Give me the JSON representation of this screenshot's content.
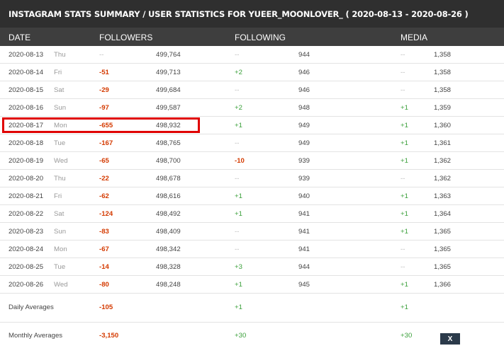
{
  "header": {
    "title": "INSTAGRAM STATS SUMMARY / USER STATISTICS FOR YUEER_MOONLOVER_ ( 2020-08-13 - 2020-08-26 )"
  },
  "columns": {
    "date": "DATE",
    "followers": "FOLLOWERS",
    "following": "FOLLOWING",
    "media": "MEDIA"
  },
  "rows": [
    {
      "date": "2020-08-13",
      "day": "Thu",
      "fd": "--",
      "fv": "499,764",
      "gd": "--",
      "gv": "944",
      "md": "--",
      "mv": "1,358"
    },
    {
      "date": "2020-08-14",
      "day": "Fri",
      "fd": "-51",
      "fv": "499,713",
      "gd": "+2",
      "gv": "946",
      "md": "--",
      "mv": "1,358"
    },
    {
      "date": "2020-08-15",
      "day": "Sat",
      "fd": "-29",
      "fv": "499,684",
      "gd": "--",
      "gv": "946",
      "md": "--",
      "mv": "1,358"
    },
    {
      "date": "2020-08-16",
      "day": "Sun",
      "fd": "-97",
      "fv": "499,587",
      "gd": "+2",
      "gv": "948",
      "md": "+1",
      "mv": "1,359"
    },
    {
      "date": "2020-08-17",
      "day": "Mon",
      "fd": "-655",
      "fv": "498,932",
      "gd": "+1",
      "gv": "949",
      "md": "+1",
      "mv": "1,360"
    },
    {
      "date": "2020-08-18",
      "day": "Tue",
      "fd": "-167",
      "fv": "498,765",
      "gd": "--",
      "gv": "949",
      "md": "+1",
      "mv": "1,361"
    },
    {
      "date": "2020-08-19",
      "day": "Wed",
      "fd": "-65",
      "fv": "498,700",
      "gd": "-10",
      "gv": "939",
      "md": "+1",
      "mv": "1,362"
    },
    {
      "date": "2020-08-20",
      "day": "Thu",
      "fd": "-22",
      "fv": "498,678",
      "gd": "--",
      "gv": "939",
      "md": "--",
      "mv": "1,362"
    },
    {
      "date": "2020-08-21",
      "day": "Fri",
      "fd": "-62",
      "fv": "498,616",
      "gd": "+1",
      "gv": "940",
      "md": "+1",
      "mv": "1,363"
    },
    {
      "date": "2020-08-22",
      "day": "Sat",
      "fd": "-124",
      "fv": "498,492",
      "gd": "+1",
      "gv": "941",
      "md": "+1",
      "mv": "1,364"
    },
    {
      "date": "2020-08-23",
      "day": "Sun",
      "fd": "-83",
      "fv": "498,409",
      "gd": "--",
      "gv": "941",
      "md": "+1",
      "mv": "1,365"
    },
    {
      "date": "2020-08-24",
      "day": "Mon",
      "fd": "-67",
      "fv": "498,342",
      "gd": "--",
      "gv": "941",
      "md": "--",
      "mv": "1,365"
    },
    {
      "date": "2020-08-25",
      "day": "Tue",
      "fd": "-14",
      "fv": "498,328",
      "gd": "+3",
      "gv": "944",
      "md": "--",
      "mv": "1,365"
    },
    {
      "date": "2020-08-26",
      "day": "Wed",
      "fd": "-80",
      "fv": "498,248",
      "gd": "+1",
      "gv": "945",
      "md": "+1",
      "mv": "1,366"
    }
  ],
  "averages": {
    "daily": {
      "label": "Daily Averages",
      "followers": "-105",
      "following": "+1",
      "media": "+1"
    },
    "monthly": {
      "label": "Monthly Averages",
      "followers": "-3,150",
      "following": "+30",
      "media": "+30"
    }
  },
  "close_button": {
    "label": "X"
  },
  "colors": {
    "negative": "#d43a00",
    "positive": "#3aa03a",
    "highlight": "#e00000",
    "header_bg": "#2f2f2f"
  }
}
